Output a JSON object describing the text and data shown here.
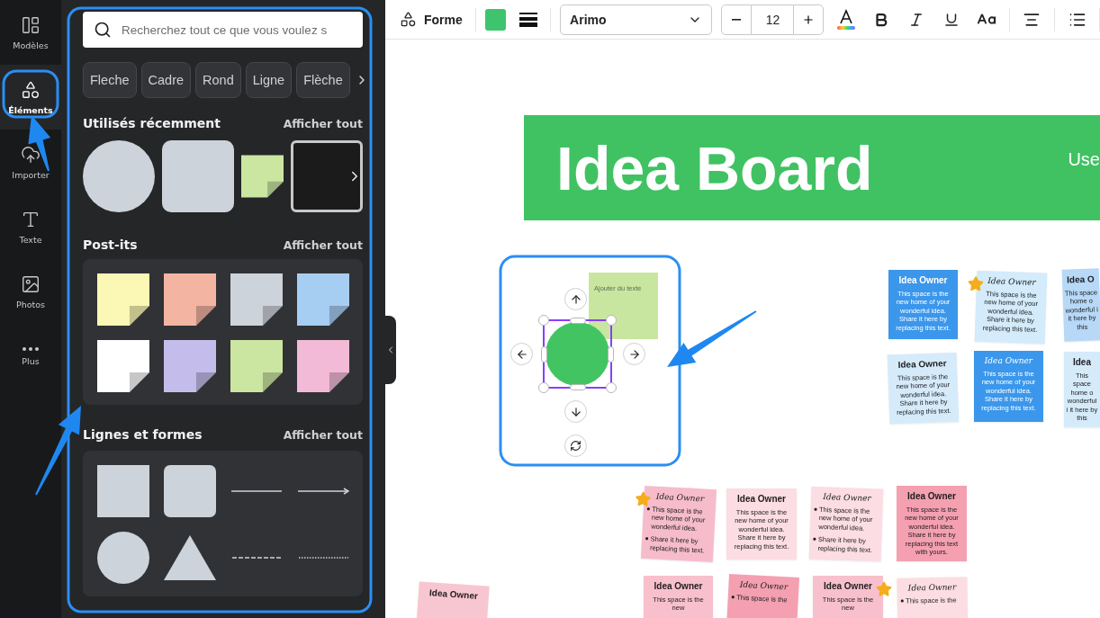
{
  "nav": {
    "items": [
      {
        "label": "Modèles",
        "selected": false
      },
      {
        "label": "Éléments",
        "selected": true
      },
      {
        "label": "Importer",
        "selected": false
      },
      {
        "label": "Texte",
        "selected": false
      },
      {
        "label": "Photos",
        "selected": false
      },
      {
        "label": "Plus",
        "selected": false
      }
    ]
  },
  "panel": {
    "search": {
      "placeholder": "Recherchez tout ce que vous voulez s"
    },
    "chips": [
      "Fleche",
      "Cadre",
      "Rond",
      "Ligne",
      "Flèche"
    ],
    "sections": [
      {
        "title": "Utilisés récemment",
        "link": "Afficher tout",
        "items": [
          {
            "kind": "circle"
          },
          {
            "kind": "rounded_square"
          },
          {
            "kind": "sticky",
            "color": "#cbe6a1"
          },
          {
            "kind": "frame"
          }
        ]
      },
      {
        "title": "Post-its",
        "link": "Afficher tout",
        "items": [
          {
            "kind": "sticky",
            "color": "#fbf7b4"
          },
          {
            "kind": "sticky",
            "color": "#f4b4a2"
          },
          {
            "kind": "sticky",
            "color": "#cdd3da"
          },
          {
            "kind": "sticky",
            "color": "#a6cdf2"
          },
          {
            "kind": "sticky",
            "color": "#ffffff"
          },
          {
            "kind": "sticky",
            "color": "#c4bdeb"
          },
          {
            "kind": "sticky",
            "color": "#cbe6a1"
          },
          {
            "kind": "sticky",
            "color": "#f2bad6"
          }
        ]
      },
      {
        "title": "Lignes et formes",
        "link": "Afficher tout",
        "items": [
          {
            "kind": "square"
          },
          {
            "kind": "rounded_square"
          },
          {
            "kind": "line"
          },
          {
            "kind": "arrow"
          },
          {
            "kind": "circle"
          },
          {
            "kind": "triangle"
          },
          {
            "kind": "dashed_line"
          },
          {
            "kind": "dotted_line"
          }
        ]
      }
    ]
  },
  "toolbar": {
    "shape_label": "Forme",
    "font": "Arimo",
    "font_size": "12"
  },
  "canvas": {
    "header": {
      "title": "Idea Board",
      "subtitle": "Use"
    },
    "selection": {
      "note_text": "Ajouter du texte"
    },
    "notes": [
      {
        "title": "Idea Owner",
        "kind": "bold",
        "color": "#3b97eb",
        "star": false,
        "body": "This space is the new home of your wonderful idea. Share it here by replacing this text."
      },
      {
        "title": "Idea Owner",
        "kind": "script",
        "color": "#d3ebfa",
        "star": true,
        "body": "This space is the new home of your wonderful idea. Share it here by replacing this text."
      },
      {
        "title": "Idea O",
        "kind": "bold",
        "color": "#b7d8f7",
        "star": false,
        "body": "This space home o wonderful i it here by this"
      },
      {
        "title": "Idea Owner",
        "kind": "bold",
        "color": "#d6ebfa",
        "star": false,
        "body": "This space is the new home of your wonderful idea. Share it here by replacing this text."
      },
      {
        "title": "Idea Owner",
        "kind": "script",
        "color": "#3b97eb",
        "star": false,
        "body": "This space is the new home of your wonderful idea. Share it here by replacing this text."
      },
      {
        "title": "Idea",
        "kind": "bold",
        "color": "#d6ebfa",
        "star": false,
        "body": "This space home o wonderful i it here by this"
      },
      {
        "title": "Idea Owner",
        "kind": "script",
        "color": "#f7bccb",
        "star": true,
        "bullets": [
          "This space is the new home of your wonderful idea.",
          "Share it here by replacing this text."
        ]
      },
      {
        "title": "Idea Owner",
        "kind": "bold",
        "color": "#fbdde3",
        "star": false,
        "body": "This space is the new home of your wonderful idea. Share it here by replacing this text."
      },
      {
        "title": "Idea Owner",
        "kind": "script",
        "color": "#fbdde3",
        "star": false,
        "bullets": [
          "This space is the new home of your wonderful idea.",
          "Share it here by replacing this text."
        ]
      },
      {
        "title": "Idea Owner",
        "kind": "bold",
        "color": "#f4a0b0",
        "star": false,
        "body": "This space is the new home of your wonderful idea. Share it here by replacing this text with yours."
      },
      {
        "title": "Idea Owner",
        "kind": "bold",
        "color": "#f8c6d0",
        "star": false
      },
      {
        "title": "Idea Owner",
        "kind": "bold",
        "color": "#f8c0cc",
        "star": false,
        "body": "This space is the new"
      },
      {
        "title": "Idea Owner",
        "kind": "script",
        "color": "#f4a0b0",
        "star": false,
        "bullets": [
          "This space is the"
        ]
      },
      {
        "title": "Idea Owner",
        "kind": "bold",
        "color": "#f8c0cc",
        "star": true,
        "body": "This space is the new"
      },
      {
        "title": "Idea Owner",
        "kind": "script",
        "color": "#fbdde3",
        "star": false,
        "bullets": [
          "This space is the"
        ]
      }
    ]
  }
}
